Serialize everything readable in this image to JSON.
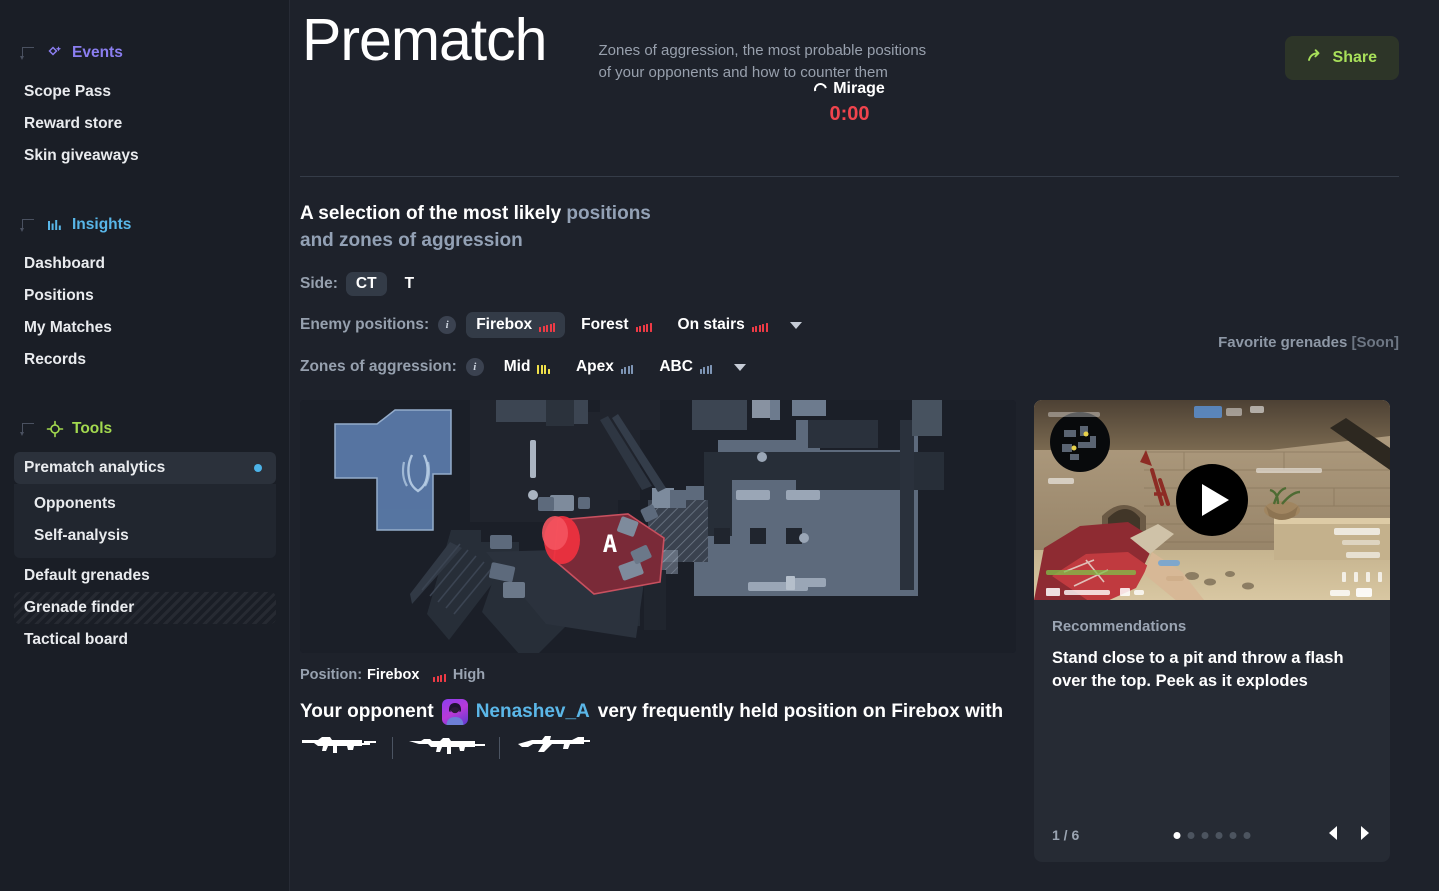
{
  "sidebar": {
    "sections": [
      {
        "id": "events",
        "label": "Events",
        "icon": "sparkle-icon",
        "color": "#8b7ef0",
        "items": [
          {
            "label": "Scope Pass"
          },
          {
            "label": "Reward store"
          },
          {
            "label": "Skin giveaways"
          }
        ]
      },
      {
        "id": "insights",
        "label": "Insights",
        "icon": "bar-chart-icon",
        "color": "#58b6e8",
        "items": [
          {
            "label": "Dashboard"
          },
          {
            "label": "Positions"
          },
          {
            "label": "My Matches"
          },
          {
            "label": "Records"
          }
        ]
      },
      {
        "id": "tools",
        "label": "Tools",
        "icon": "crosshair-icon",
        "color": "#a3d94f",
        "items": [
          {
            "label": "Prematch analytics",
            "active": true,
            "badge_dot": true
          },
          {
            "label": "Opponents",
            "sub": true
          },
          {
            "label": "Self-analysis",
            "sub": true
          },
          {
            "label": "Default grenades"
          },
          {
            "label": "Grenade finder",
            "hatched": true
          },
          {
            "label": "Tactical board"
          }
        ]
      }
    ]
  },
  "header": {
    "title": "Prematch",
    "subtitle_line1": "Zones of aggression, the most probable positions",
    "subtitle_line2": "of your opponents and how to counter them",
    "share_label": "Share",
    "share_icon": "share-arrow-icon",
    "map_name": "Mirage",
    "map_loading_icon": "spinner-icon",
    "timer": "0:00",
    "timer_color": "#f0444d"
  },
  "selection": {
    "title_bold": "A selection of the most likely ",
    "title_dim1": "positions",
    "title_dim2": "and zones of aggression",
    "side_label": "Side:",
    "sides": [
      {
        "label": "CT",
        "selected": true
      },
      {
        "label": "T",
        "selected": false
      }
    ],
    "enemy_positions_label": "Enemy positions:",
    "enemy_positions": [
      {
        "label": "Firebox",
        "selected": true,
        "bars": [
          5,
          6,
          7,
          8,
          9
        ],
        "color": "#ef3b46"
      },
      {
        "label": "Forest",
        "selected": false,
        "bars": [
          5,
          6,
          7,
          8,
          9
        ],
        "color": "#ef3b46"
      },
      {
        "label": "On stairs",
        "selected": false,
        "bars": [
          5,
          6,
          7,
          8,
          9
        ],
        "color": "#ef3b46"
      }
    ],
    "zones_label": "Zones of aggression:",
    "zones": [
      {
        "label": "Mid",
        "selected": false,
        "bars": [
          9,
          9,
          9,
          5
        ],
        "color": "#f2e24a"
      },
      {
        "label": "Apex",
        "selected": false,
        "bars": [
          5,
          7,
          8,
          9
        ],
        "color": "#7e95b5"
      },
      {
        "label": "ABC",
        "selected": false,
        "bars": [
          5,
          7,
          8,
          9
        ],
        "color": "#7e95b5"
      }
    ],
    "favorite_grenades": "Favorite grenades ",
    "favorite_grenades_soon": "[Soon]"
  },
  "map": {
    "bombsite_label": "A",
    "alt": "Mirage radar map with CT spawn zone and A bombsite"
  },
  "position_info": {
    "label": "Position:",
    "value": "Firebox",
    "rating": "High",
    "rating_bars": [
      5,
      6,
      7,
      8
    ],
    "rating_color": "#ef3b46"
  },
  "opponent": {
    "prefix": "Your opponent",
    "name": "Nenashev_A",
    "suffix": "very frequently held position on Firebox with",
    "weapons": [
      "m4a1-s-icon",
      "m4a4-icon",
      "ak47-icon"
    ]
  },
  "recommendation": {
    "section_label": "Recommendations",
    "text": "Stand close to a pit and throw a flash over the top. Peek as it explodes",
    "play_icon": "play-icon",
    "pager_count": "1 / 6",
    "dots_total": 6,
    "dots_active_index": 0,
    "prev_icon": "chevron-left-icon",
    "next_icon": "chevron-right-icon"
  }
}
